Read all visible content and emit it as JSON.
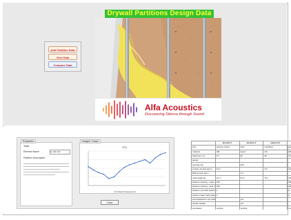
{
  "top": {
    "title": "Drywall Partitions Design Data",
    "buttons": [
      {
        "label": "Add Partition Data"
      },
      {
        "label": "View Data"
      },
      {
        "label": "Compare Data"
      }
    ],
    "logo": {
      "brand": "Alfa Acoustics",
      "tagline": "Discovering Silence through Sound"
    }
  },
  "form_screenshot": {
    "panel_tab": "Properties",
    "tab_label": "Table",
    "rows": [
      {
        "label": "Element Name"
      },
      {
        "label": "Partition Description"
      }
    ],
    "input_value": "1L-RE-CW",
    "chart_tabs": [
      "Images",
      "Graph"
    ],
    "chart_title": "STL",
    "chart_axis_label": "1/3 Octave Frequency Hz",
    "button_label": "Close",
    "chart_data": {
      "type": "line",
      "title": "STL",
      "xlabel": "1/3 Octave Frequency Hz",
      "x": [
        1,
        2,
        3,
        4,
        5,
        6,
        7,
        8,
        9,
        10,
        11,
        12,
        13,
        14,
        15,
        16
      ],
      "values": [
        42,
        38,
        35,
        33,
        28,
        30,
        36,
        41,
        44,
        46,
        48,
        50,
        46,
        52,
        56,
        58
      ],
      "ylim": [
        20,
        60
      ]
    }
  },
  "data_table": {
    "headers": [
      "",
      "element 1",
      "element 2",
      "element 3",
      "element 4"
    ],
    "rows": [
      [
        "Item",
        "gypsum board",
        "stud",
        "insulation",
        "gypsum board"
      ],
      [
        "material",
        "GB",
        "wood",
        "GS",
        "GB"
      ],
      [
        "thickness mm",
        "13",
        "90",
        "90",
        "13"
      ],
      [
        "gauge",
        "",
        "",
        "",
        ""
      ],
      [
        "spacing mm",
        "",
        "400",
        "",
        ""
      ],
      [
        "surface density kg/m²",
        "10.3",
        "",
        "4.6",
        "10.1"
      ],
      [
        "Bulk density kg/m",
        "",
        "1.6",
        "",
        ""
      ],
      [
        "total weight kg",
        "10.4",
        "61.6",
        "16.7",
        "18.4"
      ],
      [
        "fastener spacing - edge mm",
        "400",
        "",
        "",
        "400"
      ],
      [
        "fastener spacing - field mm",
        "400",
        "",
        "",
        "400"
      ],
      [
        "fastener top track pattern",
        "a",
        "",
        "",
        "a"
      ],
      [
        "fastener base track pattern",
        "a",
        "",
        "",
        "a"
      ],
      [
        "stud attached to top track",
        "",
        "yes",
        "",
        ""
      ],
      [
        "double header",
        "",
        "yes",
        "",
        ""
      ],
      [
        "orientation",
        "vertical",
        "vertical",
        "",
        "vertical"
      ]
    ]
  }
}
